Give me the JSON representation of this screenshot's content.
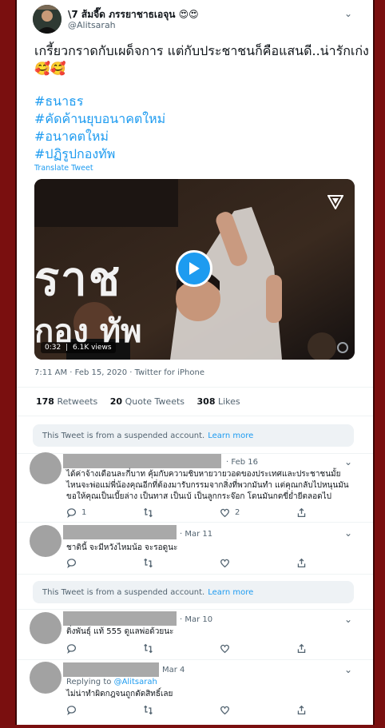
{
  "tweet": {
    "author_name": "\\7 ส้มจี๊ด ภรรยาชาธเอจุน 😍😍",
    "handle": "@Alitsarah",
    "text_line1": "เกรี้ยวกราดกับเผด็จการ แต่กับประชาชนก็คือแสนดี..น่ารักเก่ง",
    "text_line2": "🥰🥰",
    "hashtags": [
      "#ธนาธร",
      "#คัดค้านยุบอนาคตใหม่",
      "#อนาคตใหม่",
      "#ปฏิรูปกองทัพ"
    ],
    "translate_label": "Translate Tweet",
    "video": {
      "duration": "0:32",
      "views": "6.1K views",
      "overlay_text_1": "ราช",
      "overlay_text_2": "กอง ทัพ"
    },
    "meta": "7:11 AM · Feb 15, 2020 · Twitter for iPhone",
    "stats": {
      "retweets_count": "178",
      "retweets_label": "Retweets",
      "quotes_count": "20",
      "quotes_label": "Quote Tweets",
      "likes_count": "308",
      "likes_label": "Likes"
    }
  },
  "suspended_notice": {
    "text": "This Tweet is from a suspended account.",
    "link": "Learn more"
  },
  "replies": [
    {
      "date": "· Feb 16",
      "text_lines": [
        "ได้ค่าจ้างเดือนละกี่บาท คุ้มกับความชิบหายวายวอดของประเทศและประชาชนมั้ย",
        "ไหนจะพ่อแม่พี่น้องคุณอีกที่ต้องมารับกรรมจากสิ่งที่พวกมันทำ แต่คุณกลับไปหนุนมัน",
        "ขอให้คุณเป็นเบี้ยล่าง เป็นทาส เป็นเบ้ เป็นลูกกระจ๊อก โดนมันกดขี่ย่ำยีตลอดไป"
      ],
      "replies_count": "1",
      "retweets_count": "",
      "likes_count": "2"
    },
    {
      "date": "· Mar 11",
      "text_lines": [
        "ชาตินี้ จะมีหวังไหมน้อ จะรอดูนะ"
      ],
      "replies_count": "",
      "retweets_count": "",
      "likes_count": ""
    },
    {
      "date": "· Mar 10",
      "text_lines": [
        "ติ่งพันธุ์ แท้ 555 ดูแลพ่อด้วยนะ"
      ],
      "replies_count": "",
      "retweets_count": "",
      "likes_count": ""
    },
    {
      "date": "Mar 4",
      "replying_to_label": "Replying to",
      "replying_to_handle": "@Alitsarah",
      "text_lines": [
        "ไม่น่าทำผิดกฎจนถูกตัดสิทธิ์เลย"
      ],
      "replies_count": "",
      "retweets_count": "",
      "likes_count": ""
    }
  ],
  "icons": {
    "reply": "reply-icon",
    "retweet": "retweet-icon",
    "like": "heart-icon",
    "share": "share-icon",
    "more": "chevron-down-icon"
  },
  "colors": {
    "accent": "#1d9bf0",
    "frame": "#7a0f0f",
    "suspended_bg": "#eef2f5",
    "redaction": "#a9a9a9"
  }
}
